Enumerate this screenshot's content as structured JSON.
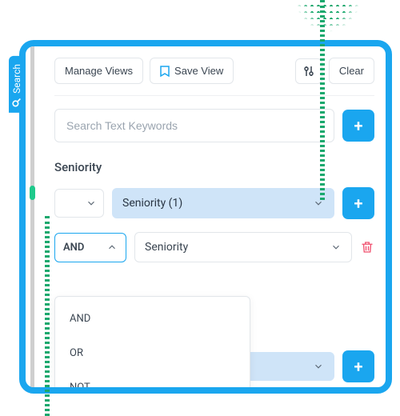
{
  "sideTab": {
    "label": "Search"
  },
  "toolbar": {
    "manage": "Manage Views",
    "save": "Save View",
    "clear": "Clear"
  },
  "search": {
    "placeholder": "Search Text Keywords"
  },
  "section": {
    "label": "Seniority"
  },
  "mainSelect": {
    "label": "Seniority (1)"
  },
  "operator": {
    "current": "AND",
    "options": [
      "AND",
      "OR",
      "NOT"
    ]
  },
  "subSelect": {
    "label": "Seniority"
  },
  "bottomSelect": {
    "label": ""
  }
}
